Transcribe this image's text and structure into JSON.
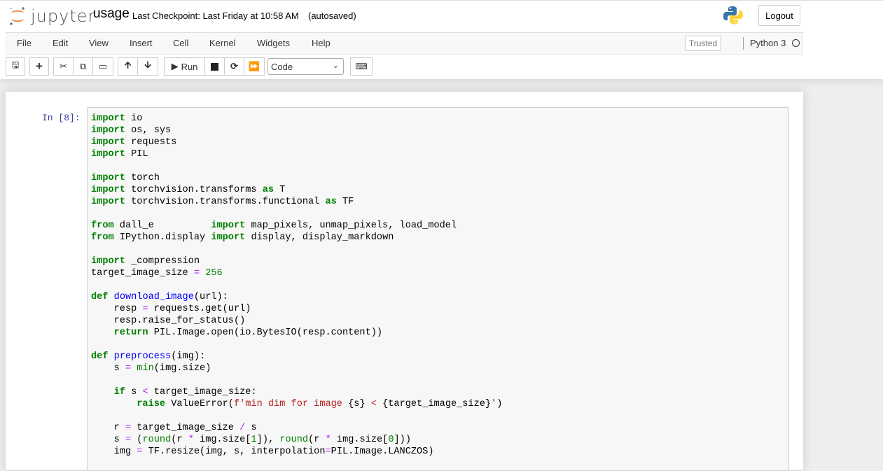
{
  "header": {
    "logo_text": "jupyter",
    "notebook_name": "usage",
    "checkpoint": "Last Checkpoint: Last Friday at 10:58 AM",
    "autosave": "(autosaved)",
    "logout_label": "Logout"
  },
  "menubar": {
    "items": [
      "File",
      "Edit",
      "View",
      "Insert",
      "Cell",
      "Kernel",
      "Widgets",
      "Help"
    ],
    "trusted_label": "Trusted",
    "kernel_name": "Python 3"
  },
  "toolbar": {
    "run_label": "Run",
    "cell_type": "Code"
  },
  "cell": {
    "prompt": "In [8]:",
    "lines": [
      [
        [
          "k",
          "import"
        ],
        [
          "n",
          " io"
        ]
      ],
      [
        [
          "k",
          "import"
        ],
        [
          "n",
          " os, sys"
        ]
      ],
      [
        [
          "k",
          "import"
        ],
        [
          "n",
          " requests"
        ]
      ],
      [
        [
          "k",
          "import"
        ],
        [
          "n",
          " PIL"
        ]
      ],
      [],
      [
        [
          "k",
          "import"
        ],
        [
          "n",
          " torch"
        ]
      ],
      [
        [
          "k",
          "import"
        ],
        [
          "n",
          " torchvision.transforms "
        ],
        [
          "k",
          "as"
        ],
        [
          "n",
          " T"
        ]
      ],
      [
        [
          "k",
          "import"
        ],
        [
          "n",
          " torchvision.transforms.functional "
        ],
        [
          "k",
          "as"
        ],
        [
          "n",
          " TF"
        ]
      ],
      [],
      [
        [
          "k",
          "from"
        ],
        [
          "n",
          " dall_e          "
        ],
        [
          "k",
          "import"
        ],
        [
          "n",
          " map_pixels, unmap_pixels, load_model"
        ]
      ],
      [
        [
          "k",
          "from"
        ],
        [
          "n",
          " IPython.display "
        ],
        [
          "k",
          "import"
        ],
        [
          "n",
          " display, display_markdown"
        ]
      ],
      [],
      [
        [
          "k",
          "import"
        ],
        [
          "n",
          " _compression"
        ]
      ],
      [
        [
          "n",
          "target_image_size "
        ],
        [
          "o",
          "="
        ],
        [
          "n",
          " "
        ],
        [
          "m",
          "256"
        ]
      ],
      [],
      [
        [
          "k",
          "def"
        ],
        [
          "n",
          " "
        ],
        [
          "f",
          "download_image"
        ],
        [
          "n",
          "(url):"
        ]
      ],
      [
        [
          "n",
          "    resp "
        ],
        [
          "o",
          "="
        ],
        [
          "n",
          " requests.get(url)"
        ]
      ],
      [
        [
          "n",
          "    resp.raise_for_status()"
        ]
      ],
      [
        [
          "n",
          "    "
        ],
        [
          "k",
          "return"
        ],
        [
          "n",
          " PIL.Image.open(io.BytesIO(resp.content))"
        ]
      ],
      [],
      [
        [
          "k",
          "def"
        ],
        [
          "n",
          " "
        ],
        [
          "f",
          "preprocess"
        ],
        [
          "n",
          "(img):"
        ]
      ],
      [
        [
          "n",
          "    s "
        ],
        [
          "o",
          "="
        ],
        [
          "n",
          " "
        ],
        [
          "b",
          "min"
        ],
        [
          "n",
          "(img.size)"
        ]
      ],
      [],
      [
        [
          "n",
          "    "
        ],
        [
          "k",
          "if"
        ],
        [
          "n",
          " s "
        ],
        [
          "o",
          "<"
        ],
        [
          "n",
          " target_image_size:"
        ]
      ],
      [
        [
          "n",
          "        "
        ],
        [
          "k",
          "raise"
        ],
        [
          "n",
          " ValueError("
        ],
        [
          "s",
          "f'min dim for image "
        ],
        [
          "n",
          "{s}"
        ],
        [
          "s",
          " < "
        ],
        [
          "n",
          "{target_image_size}"
        ],
        [
          "s",
          "'"
        ],
        [
          "n",
          ")"
        ]
      ],
      [],
      [
        [
          "n",
          "    r "
        ],
        [
          "o",
          "="
        ],
        [
          "n",
          " target_image_size "
        ],
        [
          "o",
          "/"
        ],
        [
          "n",
          " s"
        ]
      ],
      [
        [
          "n",
          "    s "
        ],
        [
          "o",
          "="
        ],
        [
          "n",
          " ("
        ],
        [
          "b",
          "round"
        ],
        [
          "n",
          "(r "
        ],
        [
          "o",
          "*"
        ],
        [
          "n",
          " img.size["
        ],
        [
          "m",
          "1"
        ],
        [
          "n",
          "]), "
        ],
        [
          "b",
          "round"
        ],
        [
          "n",
          "(r "
        ],
        [
          "o",
          "*"
        ],
        [
          "n",
          " img.size["
        ],
        [
          "m",
          "0"
        ],
        [
          "n",
          "]))"
        ]
      ],
      [
        [
          "n",
          "    img "
        ],
        [
          "o",
          "="
        ],
        [
          "n",
          " TF.resize(img, s, interpolation"
        ],
        [
          "o",
          "="
        ],
        [
          "n",
          "PIL.Image.LANCZOS)"
        ]
      ]
    ]
  },
  "colors": {
    "accent": "#f37726",
    "prompt": "#303f9f",
    "keyword": "#008000",
    "string": "#ba2121",
    "operator": "#aa22ff",
    "def_name": "#0000ff"
  }
}
